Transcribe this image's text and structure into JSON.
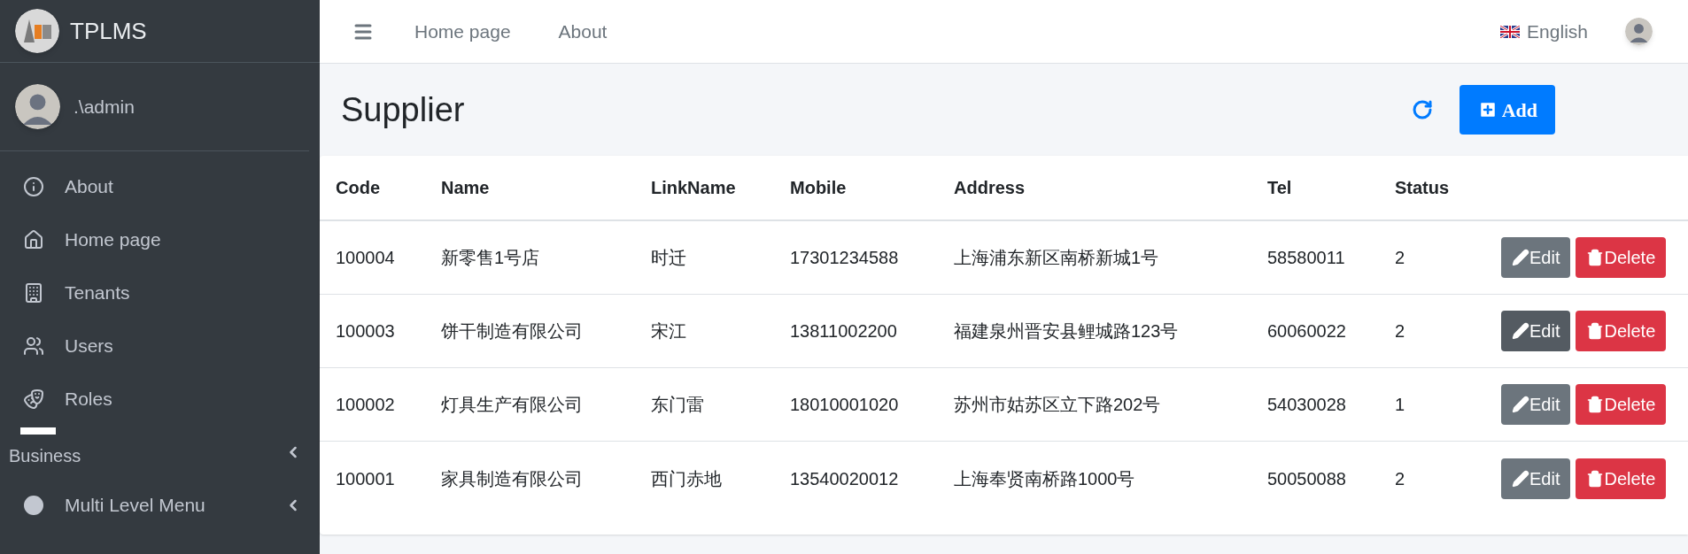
{
  "sidebar": {
    "brand": "TPLMS",
    "user": ".\\admin",
    "items": [
      {
        "label": "About",
        "kind": "info",
        "expandable": false
      },
      {
        "label": "Home page",
        "kind": "home",
        "expandable": false
      },
      {
        "label": "Tenants",
        "kind": "building",
        "expandable": false
      },
      {
        "label": "Users",
        "kind": "users",
        "expandable": false
      },
      {
        "label": "Roles",
        "kind": "masks",
        "expandable": false
      },
      {
        "label": "Business",
        "kind": "header",
        "expandable": true
      },
      {
        "label": "Multi Level Menu",
        "kind": "circle",
        "expandable": true
      }
    ]
  },
  "topbar": {
    "links": [
      "Home page",
      "About"
    ],
    "language": "English"
  },
  "page": {
    "title": "Supplier",
    "add_button": "Add"
  },
  "table": {
    "columns": [
      "Code",
      "Name",
      "LinkName",
      "Mobile",
      "Address",
      "Tel",
      "Status"
    ],
    "rows": [
      {
        "cells": [
          "100004",
          "新零售1号店",
          "时迁",
          "17301234588",
          "上海浦东新区南桥新城1号",
          "58580011",
          "2"
        ],
        "edit": "Edit",
        "delete": "Delete",
        "edit_hovered": false
      },
      {
        "cells": [
          "100003",
          "饼干制造有限公司",
          "宋江",
          "13811002200",
          "福建泉州晋安县鲤城路123号",
          "60060022",
          "2"
        ],
        "edit": "Edit",
        "delete": "Delete",
        "edit_hovered": true
      },
      {
        "cells": [
          "100002",
          "灯具生产有限公司",
          "东门雷",
          "18010001020",
          "苏州市姑苏区立下路202号",
          "54030028",
          "1"
        ],
        "edit": "Edit",
        "delete": "Delete",
        "edit_hovered": false
      },
      {
        "cells": [
          "100001",
          "家具制造有限公司",
          "西门赤地",
          "13540020012",
          "上海奉贤南桥路1000号",
          "50050088",
          "2"
        ],
        "edit": "Edit",
        "delete": "Delete",
        "edit_hovered": false
      }
    ]
  }
}
